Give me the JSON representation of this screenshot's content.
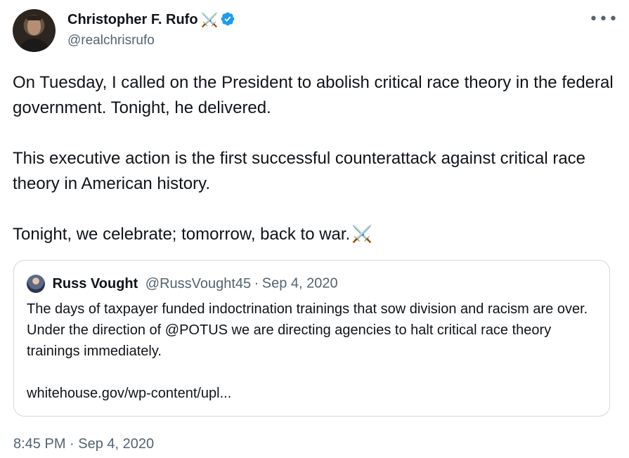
{
  "author": {
    "display_name": "Christopher F. Rufo",
    "name_emoji": "⚔️",
    "handle": "@realchrisrufo",
    "verified": true
  },
  "more_label": "•••",
  "tweet": {
    "para1": "On Tuesday, I called on the President to abolish critical race theory in the federal government. Tonight, he delivered.",
    "para2": "This executive action is the first successful counterattack against critical race theory in American history.",
    "para3": "Tonight, we celebrate; tomorrow, back to war.",
    "para3_emoji": "⚔️"
  },
  "quote": {
    "name": "Russ Vought",
    "handle": "@RussVought45",
    "separator": "·",
    "date": "Sep 4, 2020",
    "text": "The days of taxpayer funded indoctrination trainings that sow division and racism are over. Under the direction of @POTUS we are directing agencies to halt critical race theory trainings immediately.",
    "link": "whitehouse.gov/wp-content/upl..."
  },
  "timestamp": "8:45 PM · Sep 4, 2020",
  "colors": {
    "text": "#0f1419",
    "secondary": "#536471",
    "border": "#cfd9de",
    "verified": "#1d9bf0"
  }
}
